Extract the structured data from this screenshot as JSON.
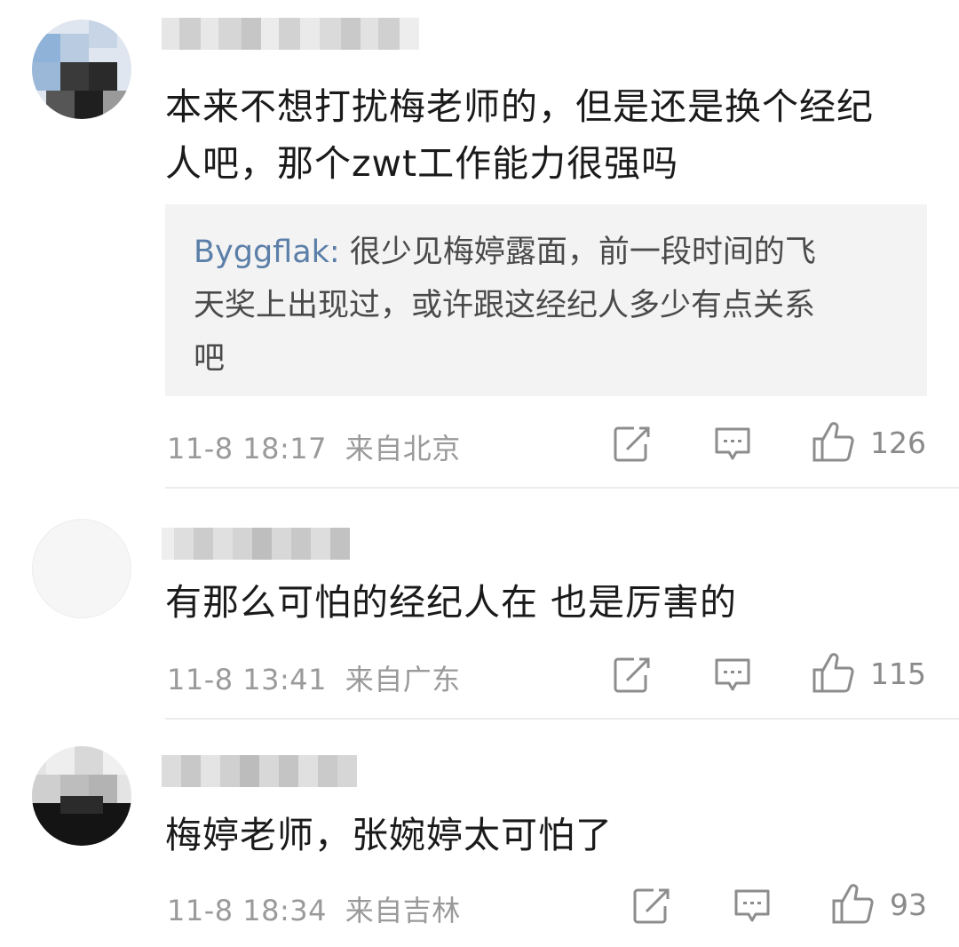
{
  "comments": [
    {
      "text_line1": "本来不想打扰梅老师的，但是还是换个经纪",
      "text_line2": "人吧，那个zwt工作能力很强吗",
      "reply": {
        "user": "Byggflak:",
        "line1": " 很少见梅婷露面，前一段时间的飞",
        "line2": "天奖上出现过，或许跟这经纪人多少有点关系",
        "line3": "吧"
      },
      "time": "11-8 18:17",
      "location": "来自北京",
      "likes": "126"
    },
    {
      "text_line1": "有那么可怕的经纪人在 也是厉害的",
      "time": "11-8 13:41",
      "location": "来自广东",
      "likes": "115"
    },
    {
      "text_line1": "梅婷老师，张婉婷太可怕了",
      "time": "11-8 18:34",
      "location": "来自吉林",
      "likes": "93"
    }
  ],
  "icons": {
    "share": "share-icon",
    "comment": "comment-icon",
    "like": "thumbs-up-icon"
  },
  "colors": {
    "reply_user": "#5b7fa8",
    "meta_text": "#9a9a9a",
    "reply_bg": "#f3f3f3"
  }
}
